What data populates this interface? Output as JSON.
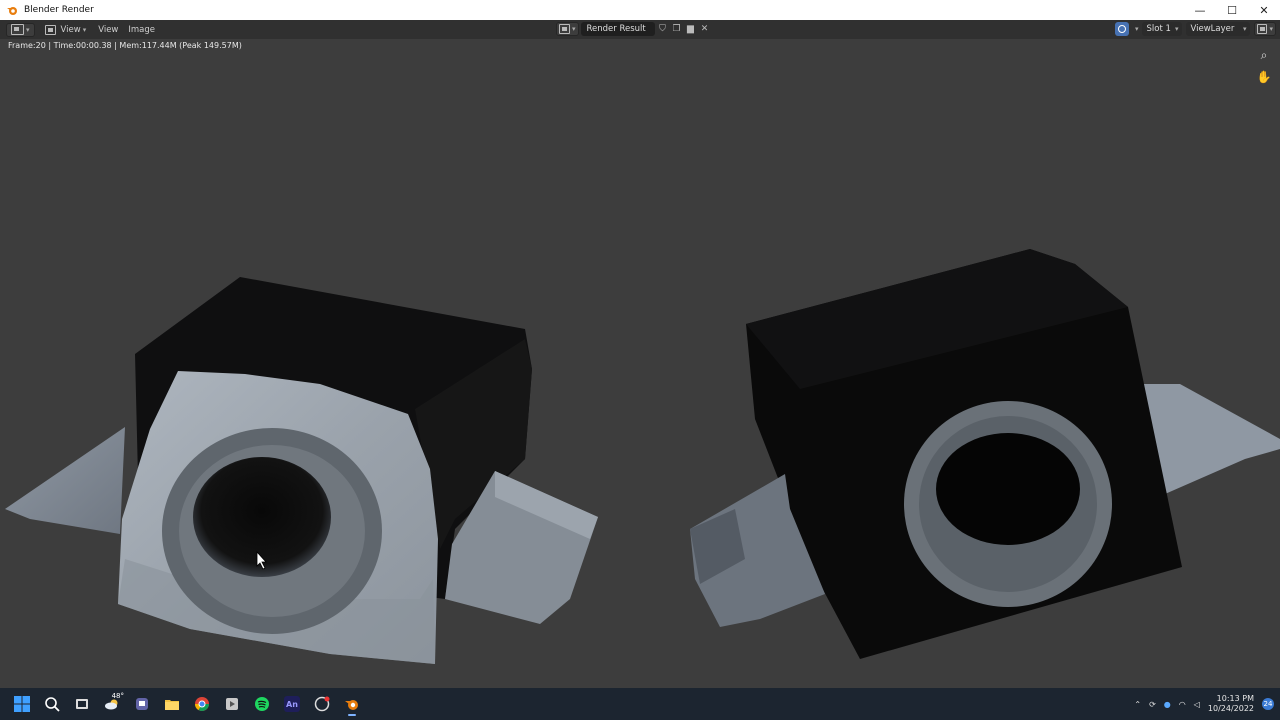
{
  "window": {
    "title": "Blender Render"
  },
  "header": {
    "menus": [
      {
        "label": "View"
      },
      {
        "label": "View"
      },
      {
        "label": "Image"
      }
    ],
    "image_name": "Render Result",
    "slot": "Slot 1",
    "view_layer": "ViewLayer"
  },
  "viewport": {
    "stats": "Frame:20 | Time:00:00.38 | Mem:117.44M (Peak 149.57M)"
  },
  "taskbar": {
    "weather": "48°",
    "animate_label": "An",
    "time": "10:13 PM",
    "date": "10/24/2022",
    "notifications": "24"
  },
  "colors": {
    "viewport_bg": "#3d3d3d",
    "header_bg": "#303030",
    "accent": "#4772b3",
    "taskbar_bg": "#1c2530"
  }
}
